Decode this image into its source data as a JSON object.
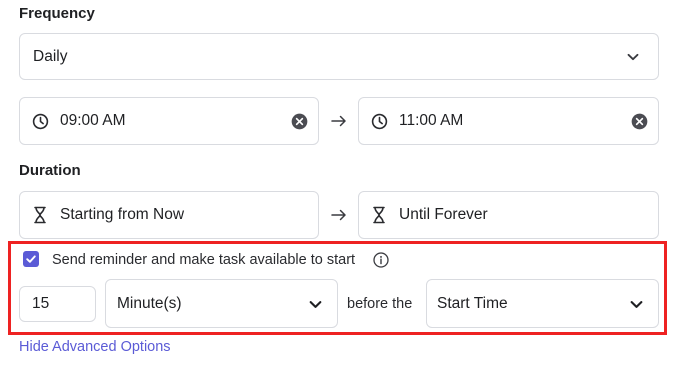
{
  "frequency": {
    "label": "Frequency",
    "select_value": "Daily",
    "select_icon": "chevron-down-icon"
  },
  "time_range": {
    "start_value": "09:00 AM",
    "end_value": "11:00 AM",
    "time_icon": "clock-icon",
    "clear_icon": "clear-circle-icon",
    "arrow_icon": "arrow-right-icon"
  },
  "duration": {
    "label": "Duration",
    "start_value": "Starting from Now",
    "end_value": "Until Forever",
    "icon": "hourglass-icon"
  },
  "reminder": {
    "checked": true,
    "checkbox_label": "Send reminder and make task available to start",
    "info_icon": "info-icon",
    "amount_value": "15",
    "unit_value": "Minute(s)",
    "connector_text": "before the",
    "reference_value": "Start Time"
  },
  "advanced": {
    "toggle_label": "Hide Advanced Options"
  },
  "colors": {
    "accent": "#5b5bd6",
    "highlight_border": "#ee2222",
    "border": "#d9dbe0",
    "text": "#1f2023"
  }
}
